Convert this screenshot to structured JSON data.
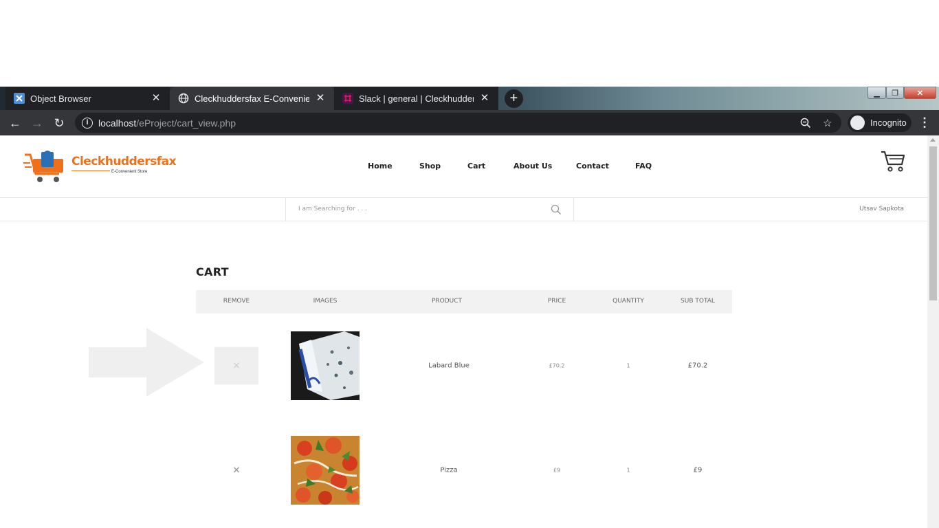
{
  "browser": {
    "tabs": [
      {
        "title": "Object Browser",
        "favicon": "object-browser-icon",
        "active": false
      },
      {
        "title": "Cleckhuddersfax E-Convenient St",
        "favicon": "globe-icon",
        "active": true
      },
      {
        "title": "Slack | general | Cleckhuddersfax",
        "favicon": "slack-icon",
        "active": false
      }
    ],
    "url_host": "localhost",
    "url_path": "/eProject/cart_view.php",
    "profile_label": "Incognito"
  },
  "site": {
    "brand": "Cleckhuddersfax",
    "tagline": "E-Convenient Store",
    "brand_color": "#f0701a",
    "nav": [
      "Home",
      "Shop",
      "Cart",
      "About Us",
      "Contact",
      "FAQ"
    ],
    "search_placeholder": "I am Searching for . . .",
    "username": "Utsav Sapkota"
  },
  "cart": {
    "heading": "CART",
    "columns": [
      "REMOVE",
      "IMAGES",
      "PRODUCT",
      "PRICE",
      "QUANTITY",
      "SUB TOTAL"
    ],
    "rows": [
      {
        "product": "Labard Blue",
        "price": "£70.2",
        "quantity": "1",
        "subtotal": "£70.2",
        "image": "blue-cheese-image",
        "remove_hovered": true
      },
      {
        "product": "Pizza",
        "price": "£9",
        "quantity": "1",
        "subtotal": "£9",
        "image": "pizza-image",
        "remove_hovered": false
      }
    ]
  }
}
